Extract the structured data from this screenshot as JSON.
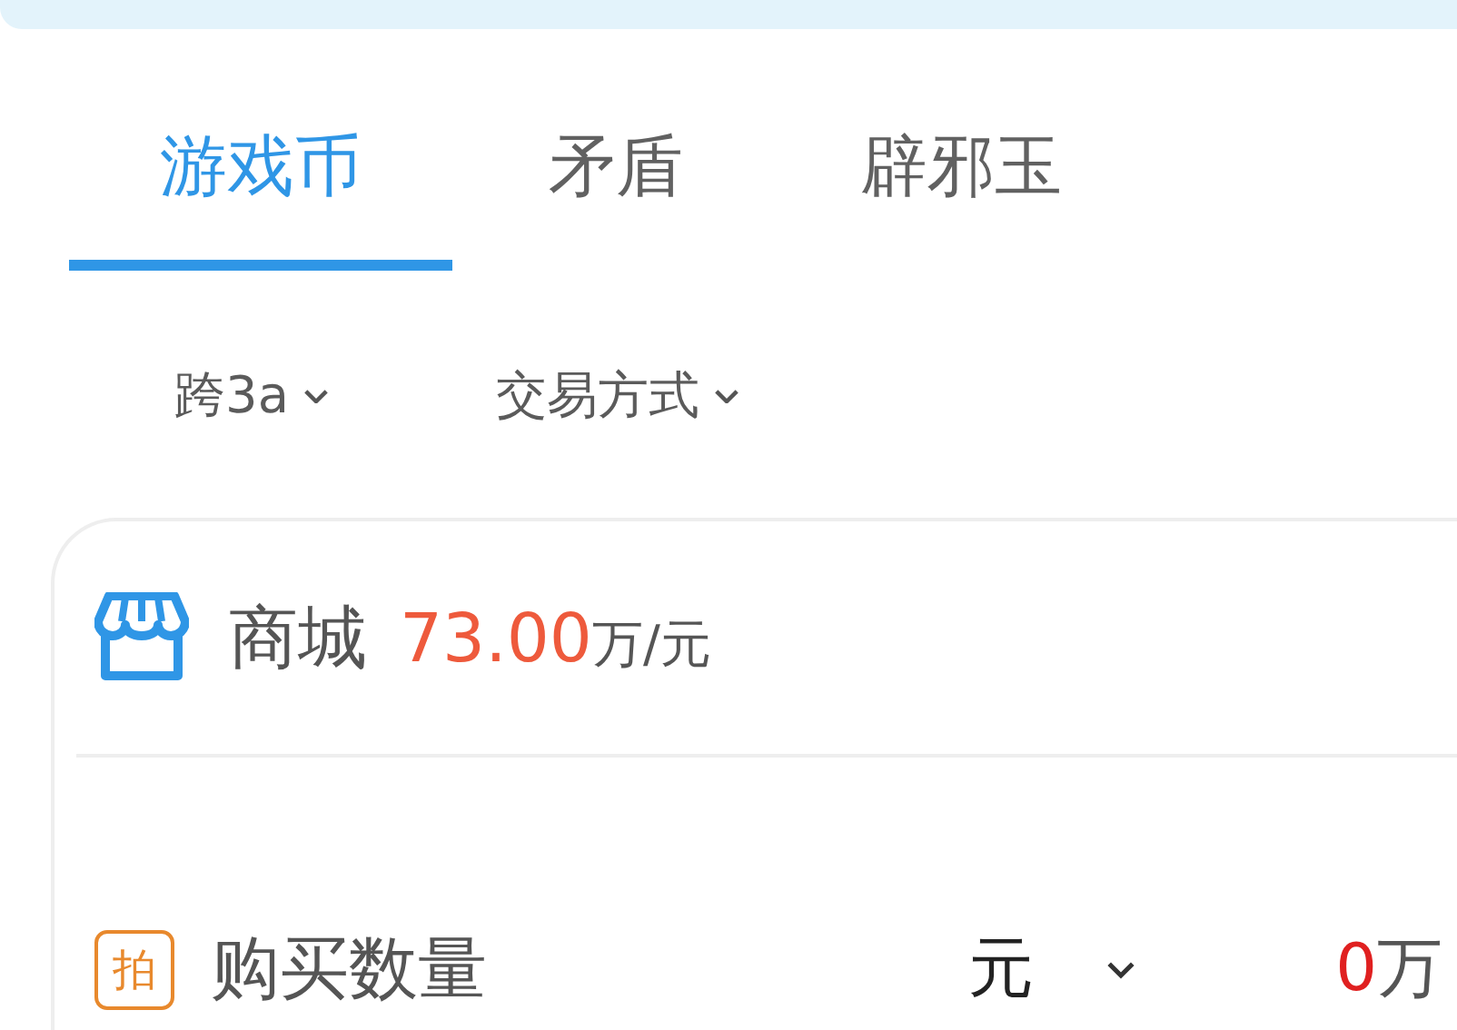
{
  "tabs": [
    {
      "label": "游戏币",
      "selected": true
    },
    {
      "label": "矛盾",
      "selected": false
    },
    {
      "label": "辟邪玉",
      "selected": false
    }
  ],
  "filters": [
    {
      "label": "跨3a"
    },
    {
      "label": "交易方式"
    }
  ],
  "mall": {
    "label": "商城",
    "price": "73.00",
    "unit": "万/元"
  },
  "purchase": {
    "badge": "拍",
    "label": "购买数量",
    "currency": "元",
    "amount": "0",
    "amount_unit": "万"
  }
}
